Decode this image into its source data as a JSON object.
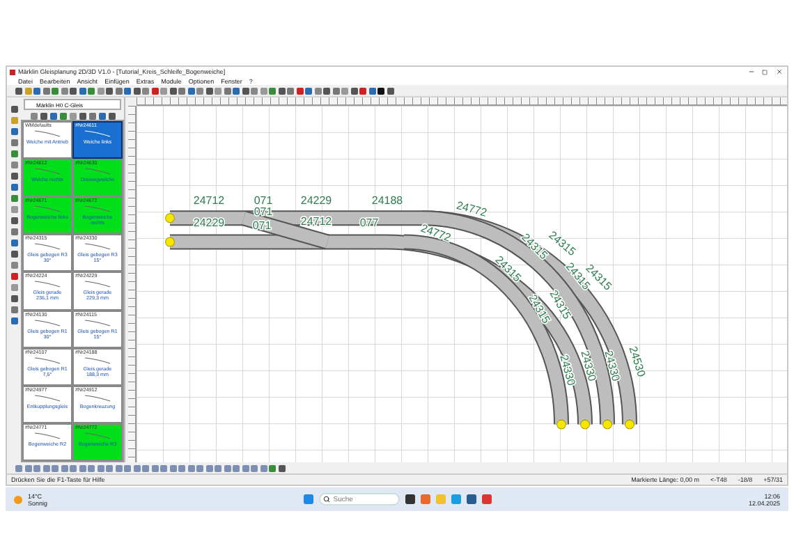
{
  "window": {
    "title": "Märklin Gleisplanung 2D/3D V1.0 - [Tutorial_Kreis_Schleife_Bogenweiche]"
  },
  "menu": [
    "Datei",
    "Bearbeiten",
    "Ansicht",
    "Einfügen",
    "Extras",
    "Module",
    "Optionen",
    "Fenster",
    "?"
  ],
  "palette": {
    "catalog": "Märklin H0 C-Gleis",
    "tiles": [
      {
        "header": "WMdefaults",
        "caption": "Weiche mit Antrieb",
        "selected": false,
        "color": "#ffffff"
      },
      {
        "header": "#Nr24611",
        "caption": "Weiche links",
        "selected": true,
        "color": "#1a6fd0"
      },
      {
        "header": "#Nr24612",
        "caption": "Weiche rechts",
        "selected": false,
        "color": "#00e01a"
      },
      {
        "header": "#Nr24630",
        "caption": "Dreiwegweiche",
        "selected": false,
        "color": "#00e01a"
      },
      {
        "header": "#Nr24671",
        "caption": "Bogenweiche links",
        "selected": false,
        "color": "#00e01a"
      },
      {
        "header": "#Nr24672",
        "caption": "Bogenweiche rechts",
        "selected": false,
        "color": "#00e01a"
      },
      {
        "header": "#Nr24315",
        "caption": "Gleis gebogen R3 30°",
        "selected": false,
        "color": "#ffffff"
      },
      {
        "header": "#Nr24330",
        "caption": "Gleis gebogen R3 15°",
        "selected": false,
        "color": "#ffffff"
      },
      {
        "header": "#Nr24224",
        "caption": "Gleis gerade 236,1 mm",
        "selected": false,
        "color": "#ffffff"
      },
      {
        "header": "#Nr24229",
        "caption": "Gleis gerade 229,3 mm",
        "selected": false,
        "color": "#ffffff"
      },
      {
        "header": "#Nr24130",
        "caption": "Gleis gebogen R1 30°",
        "selected": false,
        "color": "#ffffff"
      },
      {
        "header": "#Nr24115",
        "caption": "Gleis gebogen R1 15°",
        "selected": false,
        "color": "#ffffff"
      },
      {
        "header": "#Nr24107",
        "caption": "Gleis gebogen R1 7,5°",
        "selected": false,
        "color": "#ffffff"
      },
      {
        "header": "#Nr24188",
        "caption": "Gleis gerade 188,3 mm",
        "selected": false,
        "color": "#ffffff"
      },
      {
        "header": "#Nr24977",
        "caption": "Entkupplungsgleis",
        "selected": false,
        "color": "#ffffff"
      },
      {
        "header": "#Nr24912",
        "caption": "Bogenkreuzung",
        "selected": false,
        "color": "#ffffff"
      },
      {
        "header": "#Nr24771",
        "caption": "Bogenweiche R2",
        "selected": false,
        "color": "#ffffff"
      },
      {
        "header": "#Nr24772",
        "caption": "Bogenweiche R3",
        "selected": false,
        "color": "#00e01a"
      }
    ]
  },
  "track_labels": [
    "24712",
    "071",
    "24229",
    "24188",
    "24772",
    "24229",
    "071",
    "071",
    "24712",
    "077",
    "24772",
    "24315",
    "24315",
    "24315",
    "24315",
    "24315",
    "24315",
    "24315",
    "24530",
    "24330",
    "24330",
    "24330"
  ],
  "status_bar": {
    "hint": "Drücken Sie die F1-Taste für Hilfe",
    "length": "Markierte Länge: 0,00 m",
    "fields": [
      "<-T48",
      "-18/8",
      "+57/31"
    ]
  },
  "taskbar": {
    "temperature": "14°C",
    "weather": "Sonnig",
    "search": {
      "placeholder": "Suche"
    },
    "time": "12:06",
    "date": "12.04.2025"
  }
}
